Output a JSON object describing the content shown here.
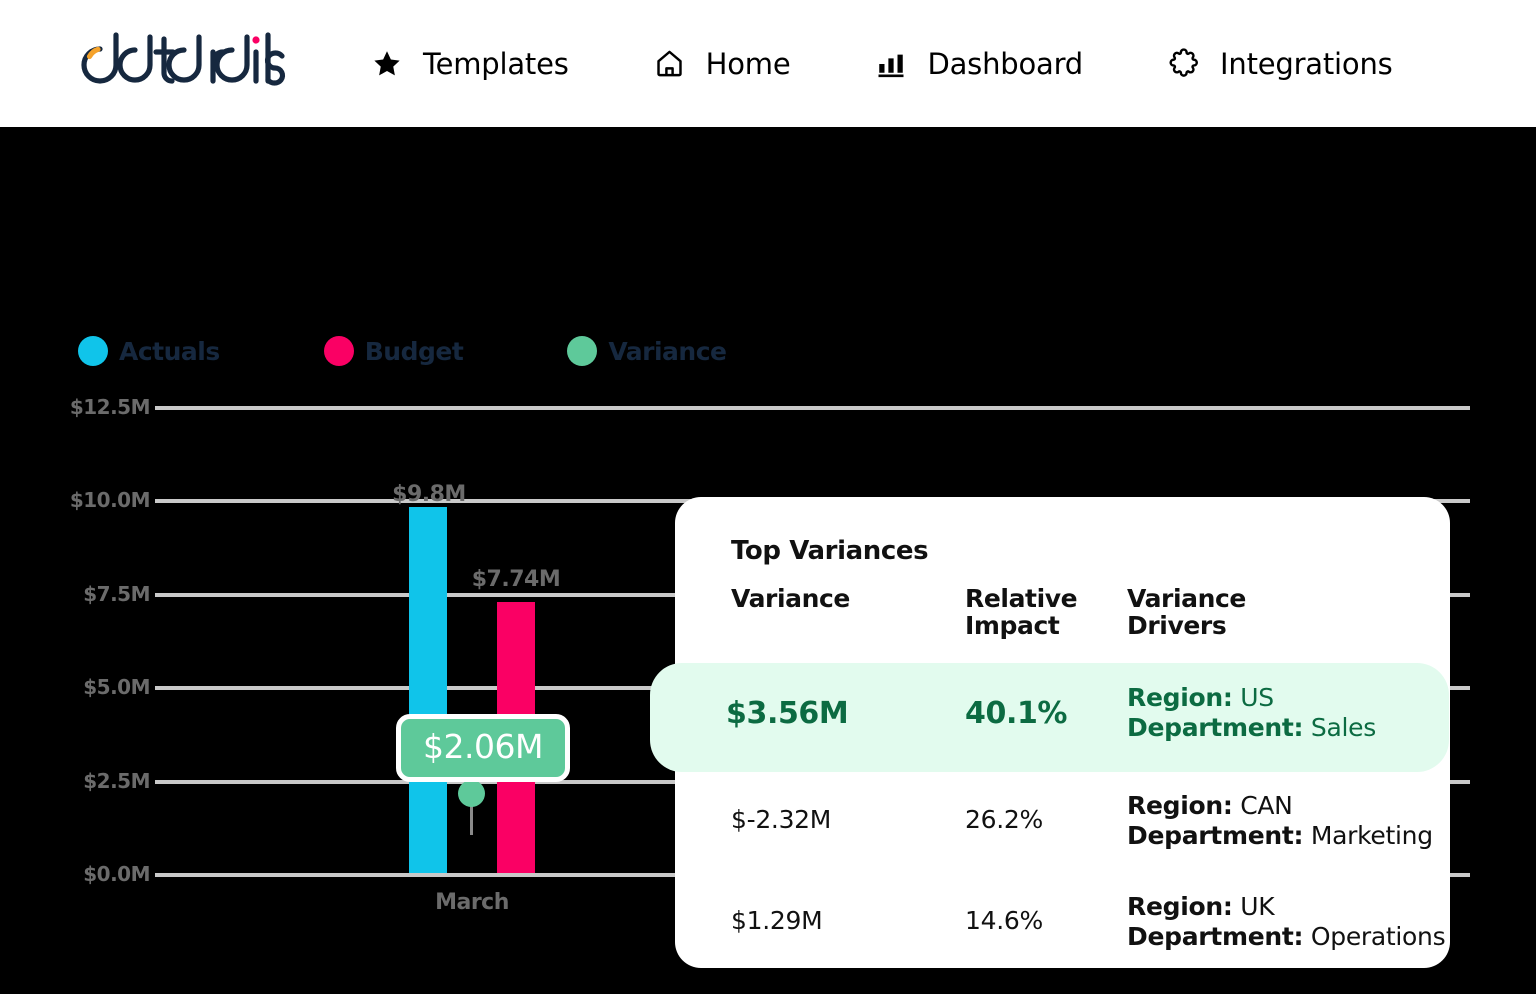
{
  "nav": {
    "logo_text": "datarails",
    "items": [
      {
        "label": "Templates",
        "icon": "star-icon"
      },
      {
        "label": "Home",
        "icon": "home-icon"
      },
      {
        "label": "Dashboard",
        "icon": "bar-chart-icon"
      },
      {
        "label": "Integrations",
        "icon": "puzzle-piece-icon"
      }
    ]
  },
  "colors": {
    "actuals": "#10c4ea",
    "budget": "#fa0064",
    "variance": "#5ec99a",
    "highlight_bg": "#e2fbee",
    "highlight_text": "#0c6b42",
    "grid": "#c9c9c9",
    "axis_text": "#6b6b6b",
    "legend_text": "#16283f",
    "canvas": "#000000"
  },
  "chart_data": {
    "type": "bar",
    "title": "",
    "xlabel": "",
    "ylabel": "",
    "categories": [
      "March"
    ],
    "series": [
      {
        "name": "Actuals",
        "values": [
          9.8
        ],
        "color": "#10c4ea",
        "labels": [
          "$9.8M"
        ]
      },
      {
        "name": "Budget",
        "values": [
          7.74
        ],
        "color": "#fa0064",
        "labels": [
          "$7.74M"
        ]
      },
      {
        "name": "Variance",
        "values": [
          2.06
        ],
        "color": "#5ec99a",
        "labels": [
          "$2.06M"
        ]
      }
    ],
    "legend": [
      "Actuals",
      "Budget",
      "Variance"
    ],
    "legend_position": "top-left",
    "ylim": [
      0,
      12.5
    ],
    "yticks": [
      0,
      2.5,
      5.0,
      7.5,
      10.0,
      12.5
    ],
    "ytick_labels": [
      "$0.0M",
      "$2.5M",
      "$5.0M",
      "$7.5M",
      "$10.0M",
      "$12.5M"
    ],
    "grid": true,
    "value_unit": "millions USD"
  },
  "panel": {
    "title": "Top Variances",
    "columns": [
      {
        "line1": "Variance",
        "line2": ""
      },
      {
        "line1": "Relative",
        "line2": "Impact"
      },
      {
        "line1": "Variance",
        "line2": "Drivers"
      }
    ],
    "rows": [
      {
        "variance": "$3.56M",
        "relative_impact": "40.1%",
        "region_label": "Region:",
        "region_value": "US",
        "department_label": "Department:",
        "department_value": "Sales",
        "highlighted": true
      },
      {
        "variance": "$-2.32M",
        "relative_impact": "26.2%",
        "region_label": "Region:",
        "region_value": "CAN",
        "department_label": "Department:",
        "department_value": "Marketing",
        "highlighted": false
      },
      {
        "variance": "$1.29M",
        "relative_impact": "14.6%",
        "region_label": "Region:",
        "region_value": "UK",
        "department_label": "Department:",
        "department_value": "Operations",
        "highlighted": false
      }
    ]
  }
}
